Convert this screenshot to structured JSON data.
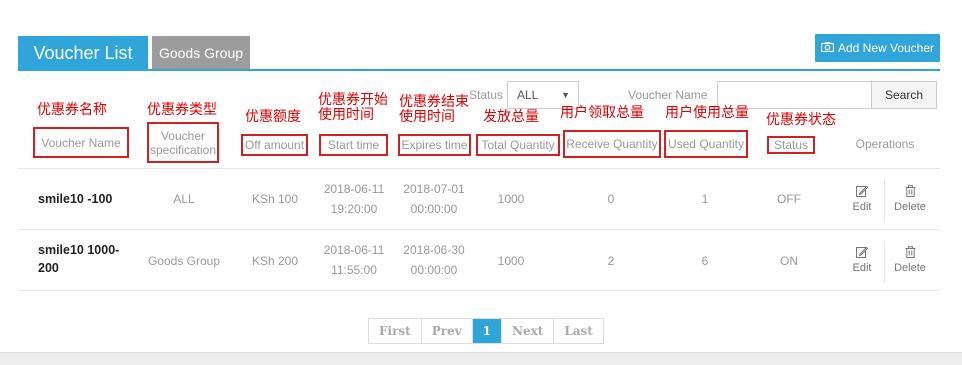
{
  "tabs": [
    {
      "label": "Voucher List",
      "active": true
    },
    {
      "label": "Goods Group",
      "active": false
    }
  ],
  "toolbar": {
    "add_label": "Add New Voucher"
  },
  "filters": {
    "status_label": "Status",
    "status_value": "ALL",
    "voucher_name_label": "Voucher Name",
    "voucher_name_value": "",
    "search_label": "Search"
  },
  "annotations": {
    "voucher_name": "优惠券名称",
    "specification": "优惠券类型",
    "off_amount": "优惠额度",
    "start_time_1": "优惠券开始",
    "start_time_2": "使用时间",
    "expires_time_1": "优惠券结束",
    "expires_time_2": "使用时间",
    "total_quantity": "发放总量",
    "receive_quantity": "用户领取总量",
    "used_quantity": "用户使用总量",
    "status": "优惠券状态"
  },
  "table": {
    "columns": {
      "voucher_name": "Voucher Name",
      "specification_1": "Voucher",
      "specification_2": "specification",
      "off_amount": "Off amount",
      "start_time": "Start time",
      "expires_time": "Expires time",
      "total_quantity": "Total Quantity",
      "receive_quantity": "Receive Quantity",
      "used_quantity": "Used Quantity",
      "status": "Status",
      "operations": "Operations"
    },
    "rows": [
      {
        "name_1": "smile10 -100",
        "name_2": "",
        "specification": "ALL",
        "off_amount": "KSh 100",
        "start_date": "2018-06-11",
        "start_time": "19:20:00",
        "expires_date": "2018-07-01",
        "expires_time": "00:00:00",
        "total_quantity": "1000",
        "receive_quantity": "0",
        "used_quantity": "1",
        "status": "OFF",
        "edit": "Edit",
        "delete": "Delete"
      },
      {
        "name_1": "smile10 1000-",
        "name_2": "200",
        "specification": "Goods Group",
        "off_amount": "KSh 200",
        "start_date": "2018-06-11",
        "start_time": "11:55:00",
        "expires_date": "2018-06-30",
        "expires_time": "00:00:00",
        "total_quantity": "1000",
        "receive_quantity": "2",
        "used_quantity": "6",
        "status": "ON",
        "edit": "Edit",
        "delete": "Delete"
      }
    ]
  },
  "pagination": {
    "first": "First",
    "prev": "Prev",
    "current": "1",
    "next": "Next",
    "last": "Last"
  },
  "colors": {
    "accent": "#2fa5d9",
    "annotation": "#e00000",
    "tab_inactive": "#9c9c9c"
  }
}
